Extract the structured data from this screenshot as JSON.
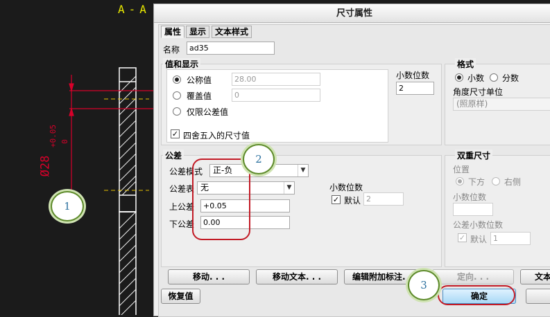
{
  "drawing": {
    "section_label": "A-A",
    "dim_text": "Ø28",
    "tol_upper": "+0.05",
    "tol_lower": "0"
  },
  "dialog": {
    "title": "尺寸属性",
    "tabs": [
      "属性",
      "显示",
      "文本样式"
    ],
    "name_label": "名称",
    "name_value": "ad35",
    "value_display": {
      "title": "值和显示",
      "nominal_label": "公称值",
      "nominal_value": "28.00",
      "override_label": "覆盖值",
      "override_value": "0",
      "tol_only_label": "仅限公差值",
      "round_label": "四舍五入的尺寸值",
      "decimals_label": "小数位数",
      "decimals_value": "2"
    },
    "format": {
      "title": "格式",
      "decimal_label": "小数",
      "fraction_label": "分数",
      "angle_unit_label": "角度尺寸单位",
      "angle_unit_value": "(照原样)"
    },
    "tolerance": {
      "title": "公差",
      "mode_label": "公差模式",
      "mode_value": "正-负",
      "table_label": "公差表",
      "table_value": "无",
      "upper_label": "上公差",
      "upper_value": "+0.05",
      "lower_label": "下公差",
      "lower_value": "0.00",
      "decimals_label": "小数位数",
      "default_label": "默认",
      "decimals_value": "2"
    },
    "dual": {
      "title": "双重尺寸",
      "position_label": "位置",
      "below_label": "下方",
      "right_label": "右侧",
      "decimals_label": "小数位数",
      "decimals_value": "",
      "tol_decimals_label": "公差小数位数",
      "default_label": "默认",
      "tol_decimals_value": "1"
    },
    "buttons": {
      "move": "移动. . .",
      "move_text": "移动文本. . .",
      "edit_attached": "编辑附加标注. . .",
      "orient": "定向. . .",
      "text": "文本",
      "restore": "恢复值",
      "ok": "确定"
    }
  },
  "callouts": [
    "1",
    "2",
    "3"
  ]
}
